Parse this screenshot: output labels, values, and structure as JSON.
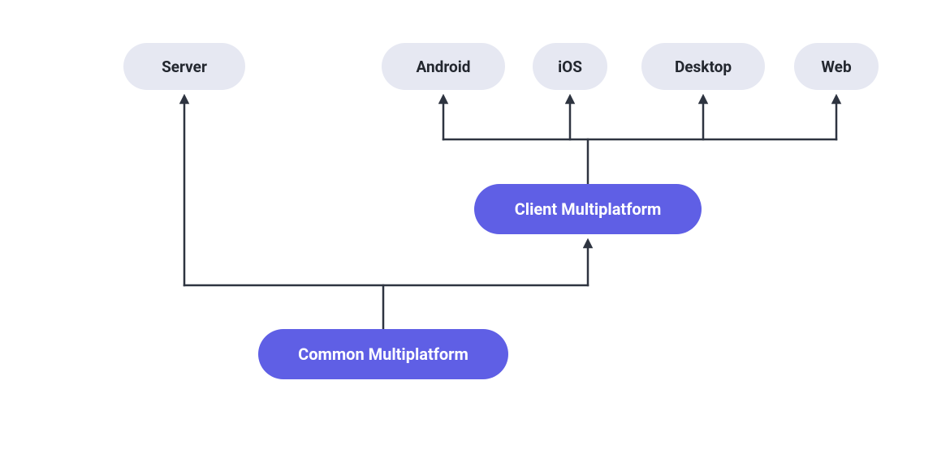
{
  "colors": {
    "node_light_bg": "#E6E8F2",
    "node_light_fg": "#23272F",
    "node_primary_bg": "#5F5FE5",
    "node_primary_fg": "#FFFFFF",
    "connector": "#2E3440"
  },
  "diagram": {
    "top_targets": {
      "server": "Server",
      "android": "Android",
      "ios": "iOS",
      "desktop": "Desktop",
      "web": "Web"
    },
    "client_multiplatform": "Client Multiplatform",
    "common_multiplatform": "Common Multiplatform",
    "relations": [
      {
        "from": "common_multiplatform",
        "to": "server"
      },
      {
        "from": "common_multiplatform",
        "to": "client_multiplatform"
      },
      {
        "from": "client_multiplatform",
        "to": "android"
      },
      {
        "from": "client_multiplatform",
        "to": "ios"
      },
      {
        "from": "client_multiplatform",
        "to": "desktop"
      },
      {
        "from": "client_multiplatform",
        "to": "web"
      }
    ]
  }
}
